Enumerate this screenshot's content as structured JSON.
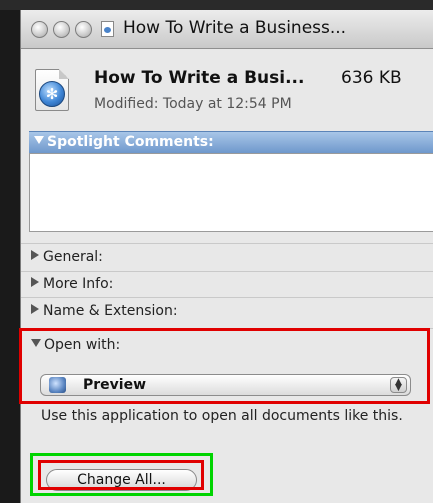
{
  "window": {
    "title": "How To Write a Business..."
  },
  "header": {
    "file_name": "How To Write a Busi...",
    "file_size": "636 KB",
    "modified": "Modified: Today at 12:54 PM",
    "file_icon": "safari-document-icon"
  },
  "spotlight": {
    "label": "Spotlight Comments:",
    "comment_value": ""
  },
  "sections": {
    "general": "General:",
    "more_info": "More Info:",
    "name_extension": "Name & Extension:",
    "open_with": "Open with:"
  },
  "open_with": {
    "selected_app": "Preview",
    "app_icon": "preview-app-icon",
    "description": "Use this application to open all documents like this.",
    "change_all_label": "Change All..."
  },
  "annotations": {
    "red_color": "#e00000",
    "green_color": "#00d400"
  }
}
